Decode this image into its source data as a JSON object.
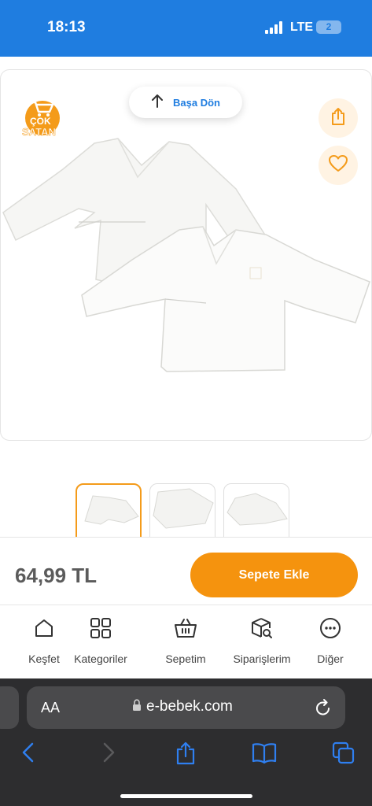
{
  "status_bar": {
    "time": "18:13",
    "network": "LTE",
    "battery_badge": "2"
  },
  "badge": {
    "line1": "ÇOK",
    "line2": "SATAN"
  },
  "back_to_top": {
    "label": "Başa Dön"
  },
  "price_bar": {
    "price": "64,99 TL",
    "add_to_cart_label": "Sepete Ekle"
  },
  "bottom_nav": {
    "items": [
      {
        "label": "Keşfet",
        "icon": "home-icon"
      },
      {
        "label": "Kategoriler",
        "icon": "grid-icon"
      },
      {
        "label": "Sepetim",
        "icon": "basket-icon"
      },
      {
        "label": "Siparişlerim",
        "icon": "box-search-icon"
      },
      {
        "label": "Diğer",
        "icon": "more-icon"
      }
    ]
  },
  "browser": {
    "text_size_label": "AA",
    "url": "e-bebek.com"
  },
  "colors": {
    "brand_blue": "#1f7de0",
    "brand_orange": "#f5930e"
  }
}
